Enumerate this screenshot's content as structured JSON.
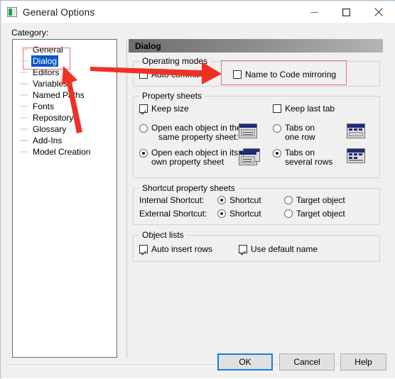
{
  "window": {
    "title": "General Options",
    "icon": "app-icon",
    "controls": [
      {
        "name": "minimize",
        "glyph": "minimize-icon"
      },
      {
        "name": "maximize",
        "glyph": "maximize-icon"
      },
      {
        "name": "close",
        "glyph": "close-icon"
      }
    ]
  },
  "category": {
    "label": "Category:",
    "items": [
      {
        "label": "General",
        "selected": false
      },
      {
        "label": "Dialog",
        "selected": true
      },
      {
        "label": "Editors",
        "selected": false
      },
      {
        "label": "Variables",
        "selected": false
      },
      {
        "label": "Named Paths",
        "selected": false
      },
      {
        "label": "Fonts",
        "selected": false
      },
      {
        "label": "Repository",
        "selected": false
      },
      {
        "label": "Glossary",
        "selected": false
      },
      {
        "label": "Add-Ins",
        "selected": false
      },
      {
        "label": "Model Creation",
        "selected": false
      }
    ]
  },
  "pane": {
    "header": "Dialog",
    "operating_modes": {
      "title": "Operating modes",
      "auto_commit": {
        "label": "Auto commit",
        "checked": false
      },
      "name_to_code": {
        "label": "Name to Code mirroring",
        "checked": false
      }
    },
    "property_sheets": {
      "title": "Property sheets",
      "keep_size": {
        "label": "Keep size",
        "checked": true
      },
      "keep_last_tab": {
        "label": "Keep last tab",
        "checked": false
      },
      "open_same": {
        "line1": "Open each object in the",
        "line2": "same property sheet:",
        "selected": false
      },
      "open_own": {
        "line1": "Open each object in its",
        "line2": "own property sheet",
        "selected": true
      },
      "tabs_one_row": {
        "line1": "Tabs on",
        "line2": "one row",
        "selected": false
      },
      "tabs_several_rows": {
        "line1": "Tabs on",
        "line2": "several rows",
        "selected": true
      }
    },
    "shortcut_property_sheets": {
      "title": "Shortcut property sheets",
      "internal_label": "Internal Shortcut:",
      "external_label": "External Shortcut:",
      "internal_shortcut": {
        "label": "Shortcut",
        "selected": true
      },
      "internal_target": {
        "label": "Target object",
        "selected": false
      },
      "external_shortcut": {
        "label": "Shortcut",
        "selected": true
      },
      "external_target": {
        "label": "Target object",
        "selected": false
      }
    },
    "object_lists": {
      "title": "Object lists",
      "auto_insert_rows": {
        "label": "Auto insert rows",
        "checked": true
      },
      "use_default_name": {
        "label": "Use default name",
        "checked": true
      }
    }
  },
  "footer": {
    "ok": "OK",
    "cancel": "Cancel",
    "help": "Help"
  },
  "annotations": {
    "color": "#e8707a",
    "arrow_color": "#ee3124",
    "highlight_tree_item": "Dialog",
    "highlight_option": "Name to Code mirroring"
  }
}
